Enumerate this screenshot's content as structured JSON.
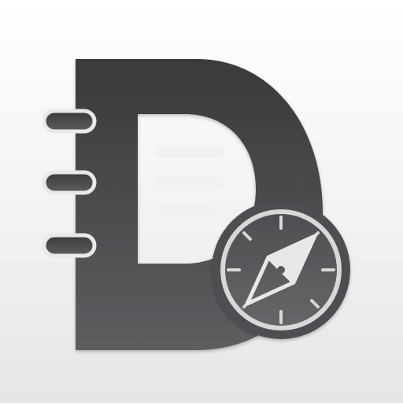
{
  "app_icon": {
    "glyph_icon": "notebook-letter-d-icon",
    "overlay_icon": "compass-icon",
    "colors": {
      "background_top": "#ffffff",
      "background_bottom": "#e6e6e6",
      "glyph_top": "#3a393b",
      "glyph_bottom": "#5e5d60",
      "line_color": "#f1f1f1",
      "compass_ring": "#d8d8d8",
      "compass_face": "#5b5a5d",
      "needle": "#e8e8e8"
    }
  }
}
